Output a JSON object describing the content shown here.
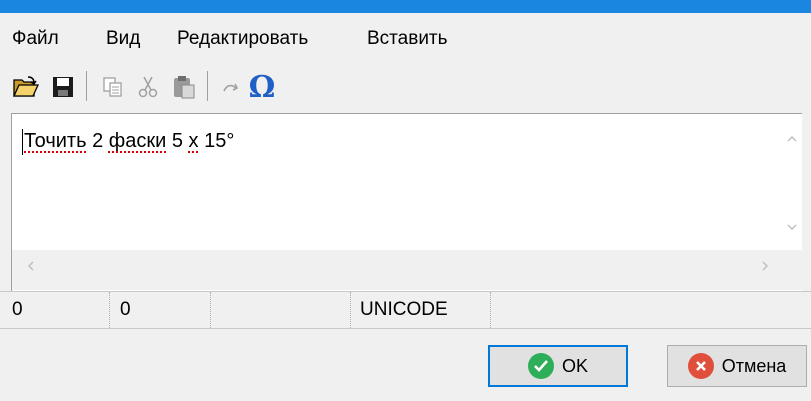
{
  "menu": {
    "file": "Файл",
    "view": "Вид",
    "edit": "Редактировать",
    "insert": "Вставить"
  },
  "toolbar": {
    "icons": [
      "open-folder-icon",
      "save-icon",
      "copy-icon",
      "cut-icon",
      "paste-icon",
      "redo-icon",
      "omega-symbol-icon"
    ],
    "omega_glyph": "Ω"
  },
  "editor": {
    "text_word1": "Точить",
    "text_mid": " 2 ",
    "text_word2": "фаски",
    "text_mid2": " 5 ",
    "text_word3": "х",
    "text_tail": " 15°"
  },
  "status": {
    "field1": "0",
    "field2": "0",
    "encoding": "UNICODE"
  },
  "buttons": {
    "ok_label": "OK",
    "cancel_label": "Отмена"
  },
  "colors": {
    "title_accent": "#1a86e0",
    "ok_icon": "#2fae5a",
    "cancel_icon": "#e04e3c"
  }
}
